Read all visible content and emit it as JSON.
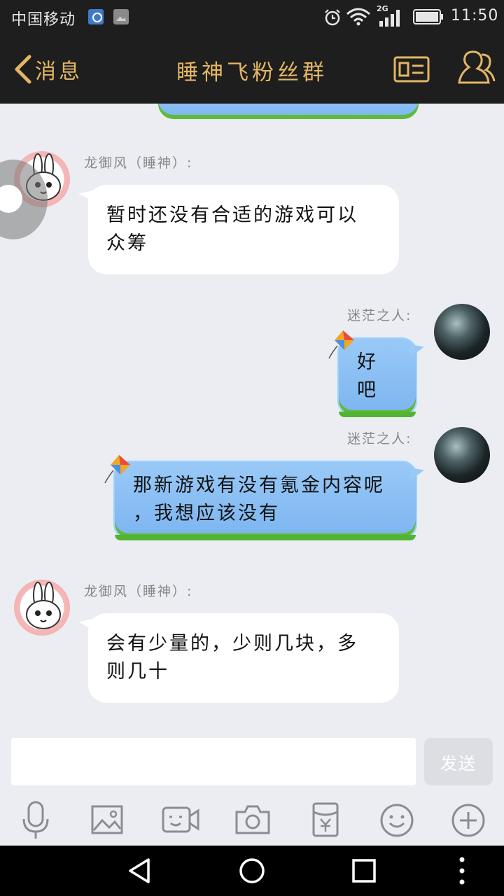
{
  "status_bar": {
    "carrier": "中国移动",
    "network": "2G",
    "time": "11:50",
    "icons": [
      "note-icon",
      "image-icon",
      "alarm-icon",
      "wifi-icon",
      "signal-icon",
      "battery-icon"
    ]
  },
  "header": {
    "back_label": "消息",
    "title": "睡神飞粉丝群",
    "icons": [
      "back-chevron-icon",
      "profile-card-icon",
      "group-members-icon"
    ],
    "accent_color": "#e2b664"
  },
  "messages": [
    {
      "side": "left",
      "sender": "龙御风（睡神）:",
      "text_line1": "暂时还没有合适的游戏可以",
      "text_line2": "众筹"
    },
    {
      "side": "right",
      "sender": "迷茫之人:",
      "text_line1": "好吧"
    },
    {
      "side": "right",
      "sender": "迷茫之人:",
      "text_line1": "那新游戏有没有氪金内容呢",
      "text_line2": "，我想应该没有"
    },
    {
      "side": "left",
      "sender": "龙御风（睡神）:",
      "text_line1": "会有少量的，少则几块，多",
      "text_line2": "则几十"
    }
  ],
  "input": {
    "value": "",
    "send_label": "发送"
  },
  "toolbar": {
    "icons": [
      "microphone-icon",
      "picture-icon",
      "video-call-icon",
      "camera-icon",
      "red-packet-icon",
      "emoji-icon",
      "plus-icon"
    ]
  },
  "navbar": {
    "icons": [
      "back-triangle-icon",
      "home-circle-icon",
      "recents-square-icon",
      "menu-dots-icon"
    ]
  }
}
